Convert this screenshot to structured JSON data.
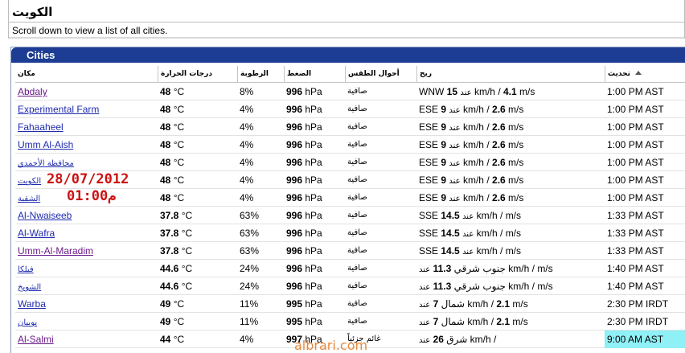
{
  "page": {
    "title": "الكويت",
    "subtitle": "Scroll down to view a list of all cities."
  },
  "panel": {
    "label": "Cities"
  },
  "columns": {
    "place": "مكان",
    "temp": "درجات الحرارة",
    "humidity": "الرطوبة",
    "pressure": "الضغط",
    "conditions": "أحوال الطقس",
    "wind": "ريح",
    "updated": "تحديث"
  },
  "rows": [
    {
      "place": "Abdaly",
      "visited": true,
      "temp_value": "48",
      "temp_unit": "°C",
      "humidity": "8%",
      "pressure_value": "996",
      "pressure_unit": "hPa",
      "conditions": "صافية",
      "wind_dir": "WNW",
      "wind_kmh": "15",
      "wind_ms": "4.1",
      "updated": "1:00 PM AST",
      "highlight": false
    },
    {
      "place": "Experimental Farm",
      "visited": false,
      "temp_value": "48",
      "temp_unit": "°C",
      "humidity": "4%",
      "pressure_value": "996",
      "pressure_unit": "hPa",
      "conditions": "صافية",
      "wind_dir": "ESE",
      "wind_kmh": "9",
      "wind_ms": "2.6",
      "updated": "1:00 PM AST",
      "highlight": false
    },
    {
      "place": "Fahaaheel",
      "visited": false,
      "temp_value": "48",
      "temp_unit": "°C",
      "humidity": "4%",
      "pressure_value": "996",
      "pressure_unit": "hPa",
      "conditions": "صافية",
      "wind_dir": "ESE",
      "wind_kmh": "9",
      "wind_ms": "2.6",
      "updated": "1:00 PM AST",
      "highlight": false
    },
    {
      "place": "Umm Al-Aish",
      "visited": false,
      "temp_value": "48",
      "temp_unit": "°C",
      "humidity": "4%",
      "pressure_value": "996",
      "pressure_unit": "hPa",
      "conditions": "صافية",
      "wind_dir": "ESE",
      "wind_kmh": "9",
      "wind_ms": "2.6",
      "updated": "1:00 PM AST",
      "highlight": false
    },
    {
      "place": "محافظة الأحمدي",
      "visited": false,
      "arabic": true,
      "temp_value": "48",
      "temp_unit": "°C",
      "humidity": "4%",
      "pressure_value": "996",
      "pressure_unit": "hPa",
      "conditions": "صافية",
      "wind_dir": "ESE",
      "wind_kmh": "9",
      "wind_ms": "2.6",
      "updated": "1:00 PM AST",
      "highlight": false
    },
    {
      "place": "الكويت",
      "visited": false,
      "arabic": true,
      "temp_value": "48",
      "temp_unit": "°C",
      "humidity": "4%",
      "pressure_value": "996",
      "pressure_unit": "hPa",
      "conditions": "صافية",
      "wind_dir": "ESE",
      "wind_kmh": "9",
      "wind_ms": "2.6",
      "updated": "1:00 PM AST",
      "highlight": false
    },
    {
      "place": "الشقية",
      "visited": false,
      "arabic": true,
      "temp_value": "48",
      "temp_unit": "°C",
      "humidity": "4%",
      "pressure_value": "996",
      "pressure_unit": "hPa",
      "conditions": "صافية",
      "wind_dir": "ESE",
      "wind_kmh": "9",
      "wind_ms": "2.6",
      "updated": "1:00 PM AST",
      "highlight": false
    },
    {
      "place": "Al-Nwaiseeb",
      "visited": false,
      "temp_value": "37.8",
      "temp_unit": "°C",
      "humidity": "63%",
      "pressure_value": "996",
      "pressure_unit": "hPa",
      "conditions": "صافية",
      "wind_dir": "SSE",
      "wind_kmh": "14.5",
      "wind_ms": "",
      "updated": "1:33 PM AST",
      "highlight": false
    },
    {
      "place": "Al-Wafra",
      "visited": false,
      "temp_value": "37.8",
      "temp_unit": "°C",
      "humidity": "63%",
      "pressure_value": "996",
      "pressure_unit": "hPa",
      "conditions": "صافية",
      "wind_dir": "SSE",
      "wind_kmh": "14.5",
      "wind_ms": "",
      "updated": "1:33 PM AST",
      "highlight": false
    },
    {
      "place": "Umm-Al-Maradim",
      "visited": true,
      "temp_value": "37.8",
      "temp_unit": "°C",
      "humidity": "63%",
      "pressure_value": "996",
      "pressure_unit": "hPa",
      "conditions": "صافية",
      "wind_dir": "SSE",
      "wind_kmh": "14.5",
      "wind_ms": "",
      "updated": "1:33 PM AST",
      "highlight": false
    },
    {
      "place": "فيلكا",
      "visited": false,
      "arabic": true,
      "temp_value": "44.6",
      "temp_unit": "°C",
      "humidity": "24%",
      "pressure_value": "996",
      "pressure_unit": "hPa",
      "conditions": "صافية",
      "wind_dir": "جنوب شرقي",
      "wind_kmh": "11.3",
      "wind_ms": "",
      "updated": "1:40 PM AST",
      "highlight": false
    },
    {
      "place": "الشويخ",
      "visited": false,
      "arabic": true,
      "temp_value": "44.6",
      "temp_unit": "°C",
      "humidity": "24%",
      "pressure_value": "996",
      "pressure_unit": "hPa",
      "conditions": "صافية",
      "wind_dir": "جنوب شرقي",
      "wind_kmh": "11.3",
      "wind_ms": "",
      "updated": "1:40 PM AST",
      "highlight": false
    },
    {
      "place": "Warba",
      "visited": false,
      "temp_value": "49",
      "temp_unit": "°C",
      "humidity": "11%",
      "pressure_value": "995",
      "pressure_unit": "hPa",
      "conditions": "صافية",
      "wind_dir": "شمال",
      "wind_kmh": "7",
      "wind_ms": "2.1",
      "updated": "2:30 PM IRDT",
      "highlight": false
    },
    {
      "place": "بوبيان",
      "visited": false,
      "arabic": true,
      "temp_value": "49",
      "temp_unit": "°C",
      "humidity": "11%",
      "pressure_value": "995",
      "pressure_unit": "hPa",
      "conditions": "صافية",
      "wind_dir": "شمال",
      "wind_kmh": "7",
      "wind_ms": "2.1",
      "updated": "2:30 PM IRDT",
      "highlight": false
    },
    {
      "place": "Al-Salmi",
      "visited": true,
      "temp_value": "44",
      "temp_unit": "°C",
      "humidity": "4%",
      "pressure_value": "997",
      "pressure_unit": "hPa",
      "conditions": "غائم جزئياً",
      "wind_dir": "شرق",
      "wind_kmh": "26",
      "wind_ms": "",
      "updated": "9:00 AM AST",
      "highlight": true
    }
  ],
  "wind_labels": {
    "at": "عند",
    "kmh": "km/h",
    "sep": "/",
    "ms": "m/s"
  },
  "overlay": {
    "date": "28/07/2012",
    "time": "01:00م",
    "watermark": "albrari.com"
  },
  "colors": {
    "bar": "#1d3d94",
    "link": "#1f2bb0",
    "visited_link": "#6a1b8a",
    "highlight": "#8ff0f5",
    "stamp": "#cc1111",
    "watermark": "#e7893c"
  }
}
